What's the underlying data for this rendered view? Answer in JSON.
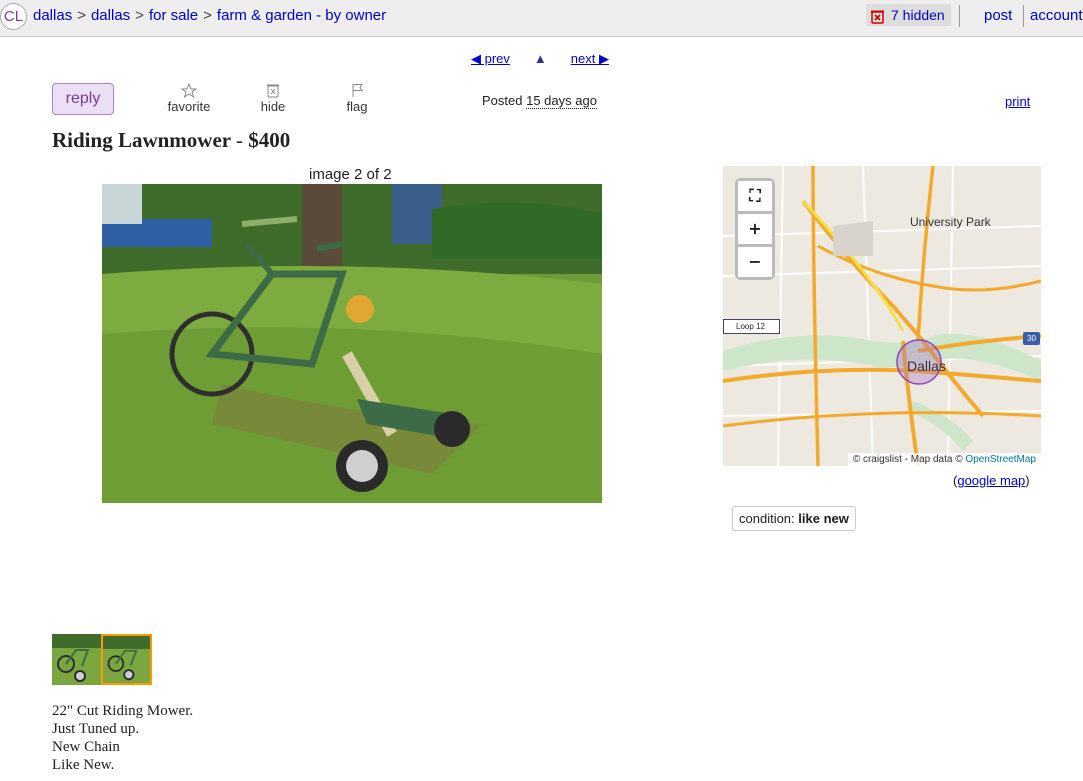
{
  "topbar": {
    "logo": "CL",
    "breadcrumbs": [
      "dallas",
      "dallas",
      "for sale",
      "farm & garden - by owner"
    ],
    "hidden_label": "7 hidden",
    "post_label": "post",
    "account_label": "account"
  },
  "pager": {
    "prev_label": "◀ prev",
    "up_label": "▲",
    "next_label": "next ▶"
  },
  "actions": {
    "reply_label": "reply",
    "favorite_label": "favorite",
    "hide_label": "hide",
    "flag_label": "flag",
    "posted_prefix": "Posted",
    "posted_when": "15 days ago",
    "print_label": "print"
  },
  "listing": {
    "title": "Riding Lawnmower",
    "separator": "-",
    "price": "$400",
    "image_caption": "image 2 of 2",
    "body_lines": [
      "22\" Cut Riding Mower.",
      "Just Tuned up.",
      "New Chain",
      "Like New."
    ]
  },
  "map": {
    "label_area": "University Park",
    "label_city": "Dallas",
    "label_loop": "Loop 12",
    "label_interstate": "30",
    "fullscreen_label": "⛶",
    "zoom_in_label": "+",
    "zoom_out_label": "−",
    "attribution_prefix": "© craigslist - Map data ©",
    "attribution_link": "OpenStreetMap",
    "google_map_open": "(",
    "google_map_label": "google map",
    "google_map_close": ")"
  },
  "attributes": {
    "condition_label": "condition:",
    "condition_value": "like new"
  },
  "colors": {
    "link": "#0000cc",
    "reply_bg": "#eadff5",
    "reply_border": "#b27fd1",
    "thumb_selected": "#ff9900",
    "hidden_icon": "#cc0000"
  }
}
